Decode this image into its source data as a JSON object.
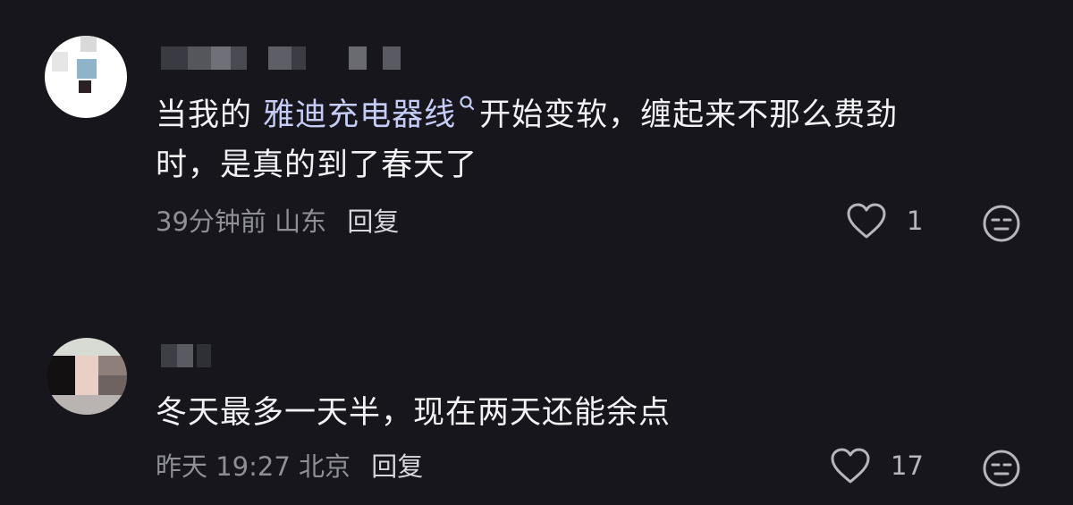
{
  "comments": [
    {
      "text_before_link": "当我的 ",
      "link_text": "雅迪充电器线",
      "text_after_link": "开始变软，缠起来不那么费劲",
      "text_line2": "时，是真的到了春天了",
      "time": "39分钟前",
      "location": "山东",
      "reply_label": "回复",
      "like_count": "1"
    },
    {
      "text": "冬天最多一天半，现在两天还能余点",
      "time": "昨天 19:27",
      "location": "北京",
      "reply_label": "回复",
      "like_count": "17"
    }
  ],
  "colors": {
    "background": "#16161c",
    "text": "#f2f2f4",
    "link": "#c5cdf7",
    "meta": "#8f8f98"
  },
  "icons": {
    "like": "heart-outline-icon",
    "reaction": "neutral-face-icon",
    "link_search": "search-icon"
  }
}
